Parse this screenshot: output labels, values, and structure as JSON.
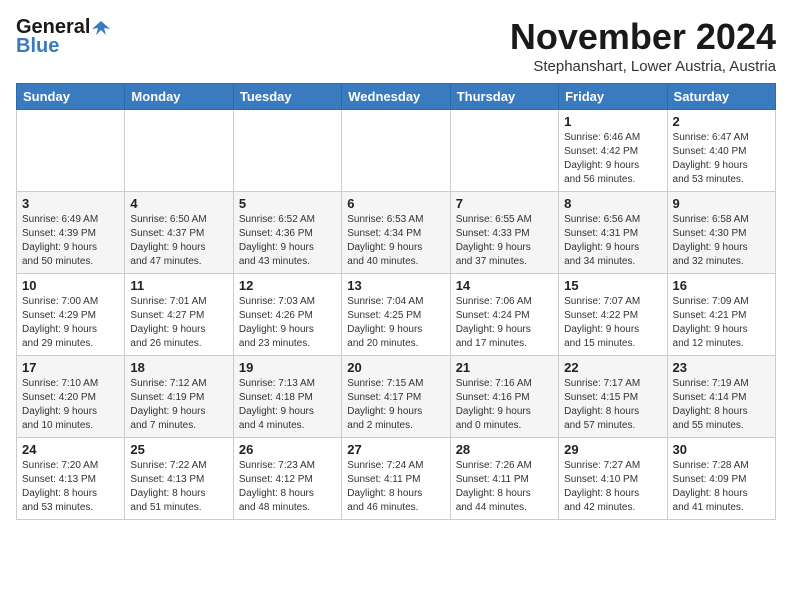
{
  "logo": {
    "line1": "General",
    "line2": "Blue"
  },
  "title": "November 2024",
  "subtitle": "Stephanshart, Lower Austria, Austria",
  "weekdays": [
    "Sunday",
    "Monday",
    "Tuesday",
    "Wednesday",
    "Thursday",
    "Friday",
    "Saturday"
  ],
  "weeks": [
    [
      {
        "day": "",
        "info": ""
      },
      {
        "day": "",
        "info": ""
      },
      {
        "day": "",
        "info": ""
      },
      {
        "day": "",
        "info": ""
      },
      {
        "day": "",
        "info": ""
      },
      {
        "day": "1",
        "info": "Sunrise: 6:46 AM\nSunset: 4:42 PM\nDaylight: 9 hours\nand 56 minutes."
      },
      {
        "day": "2",
        "info": "Sunrise: 6:47 AM\nSunset: 4:40 PM\nDaylight: 9 hours\nand 53 minutes."
      }
    ],
    [
      {
        "day": "3",
        "info": "Sunrise: 6:49 AM\nSunset: 4:39 PM\nDaylight: 9 hours\nand 50 minutes."
      },
      {
        "day": "4",
        "info": "Sunrise: 6:50 AM\nSunset: 4:37 PM\nDaylight: 9 hours\nand 47 minutes."
      },
      {
        "day": "5",
        "info": "Sunrise: 6:52 AM\nSunset: 4:36 PM\nDaylight: 9 hours\nand 43 minutes."
      },
      {
        "day": "6",
        "info": "Sunrise: 6:53 AM\nSunset: 4:34 PM\nDaylight: 9 hours\nand 40 minutes."
      },
      {
        "day": "7",
        "info": "Sunrise: 6:55 AM\nSunset: 4:33 PM\nDaylight: 9 hours\nand 37 minutes."
      },
      {
        "day": "8",
        "info": "Sunrise: 6:56 AM\nSunset: 4:31 PM\nDaylight: 9 hours\nand 34 minutes."
      },
      {
        "day": "9",
        "info": "Sunrise: 6:58 AM\nSunset: 4:30 PM\nDaylight: 9 hours\nand 32 minutes."
      }
    ],
    [
      {
        "day": "10",
        "info": "Sunrise: 7:00 AM\nSunset: 4:29 PM\nDaylight: 9 hours\nand 29 minutes."
      },
      {
        "day": "11",
        "info": "Sunrise: 7:01 AM\nSunset: 4:27 PM\nDaylight: 9 hours\nand 26 minutes."
      },
      {
        "day": "12",
        "info": "Sunrise: 7:03 AM\nSunset: 4:26 PM\nDaylight: 9 hours\nand 23 minutes."
      },
      {
        "day": "13",
        "info": "Sunrise: 7:04 AM\nSunset: 4:25 PM\nDaylight: 9 hours\nand 20 minutes."
      },
      {
        "day": "14",
        "info": "Sunrise: 7:06 AM\nSunset: 4:24 PM\nDaylight: 9 hours\nand 17 minutes."
      },
      {
        "day": "15",
        "info": "Sunrise: 7:07 AM\nSunset: 4:22 PM\nDaylight: 9 hours\nand 15 minutes."
      },
      {
        "day": "16",
        "info": "Sunrise: 7:09 AM\nSunset: 4:21 PM\nDaylight: 9 hours\nand 12 minutes."
      }
    ],
    [
      {
        "day": "17",
        "info": "Sunrise: 7:10 AM\nSunset: 4:20 PM\nDaylight: 9 hours\nand 10 minutes."
      },
      {
        "day": "18",
        "info": "Sunrise: 7:12 AM\nSunset: 4:19 PM\nDaylight: 9 hours\nand 7 minutes."
      },
      {
        "day": "19",
        "info": "Sunrise: 7:13 AM\nSunset: 4:18 PM\nDaylight: 9 hours\nand 4 minutes."
      },
      {
        "day": "20",
        "info": "Sunrise: 7:15 AM\nSunset: 4:17 PM\nDaylight: 9 hours\nand 2 minutes."
      },
      {
        "day": "21",
        "info": "Sunrise: 7:16 AM\nSunset: 4:16 PM\nDaylight: 9 hours\nand 0 minutes."
      },
      {
        "day": "22",
        "info": "Sunrise: 7:17 AM\nSunset: 4:15 PM\nDaylight: 8 hours\nand 57 minutes."
      },
      {
        "day": "23",
        "info": "Sunrise: 7:19 AM\nSunset: 4:14 PM\nDaylight: 8 hours\nand 55 minutes."
      }
    ],
    [
      {
        "day": "24",
        "info": "Sunrise: 7:20 AM\nSunset: 4:13 PM\nDaylight: 8 hours\nand 53 minutes."
      },
      {
        "day": "25",
        "info": "Sunrise: 7:22 AM\nSunset: 4:13 PM\nDaylight: 8 hours\nand 51 minutes."
      },
      {
        "day": "26",
        "info": "Sunrise: 7:23 AM\nSunset: 4:12 PM\nDaylight: 8 hours\nand 48 minutes."
      },
      {
        "day": "27",
        "info": "Sunrise: 7:24 AM\nSunset: 4:11 PM\nDaylight: 8 hours\nand 46 minutes."
      },
      {
        "day": "28",
        "info": "Sunrise: 7:26 AM\nSunset: 4:11 PM\nDaylight: 8 hours\nand 44 minutes."
      },
      {
        "day": "29",
        "info": "Sunrise: 7:27 AM\nSunset: 4:10 PM\nDaylight: 8 hours\nand 42 minutes."
      },
      {
        "day": "30",
        "info": "Sunrise: 7:28 AM\nSunset: 4:09 PM\nDaylight: 8 hours\nand 41 minutes."
      }
    ]
  ]
}
